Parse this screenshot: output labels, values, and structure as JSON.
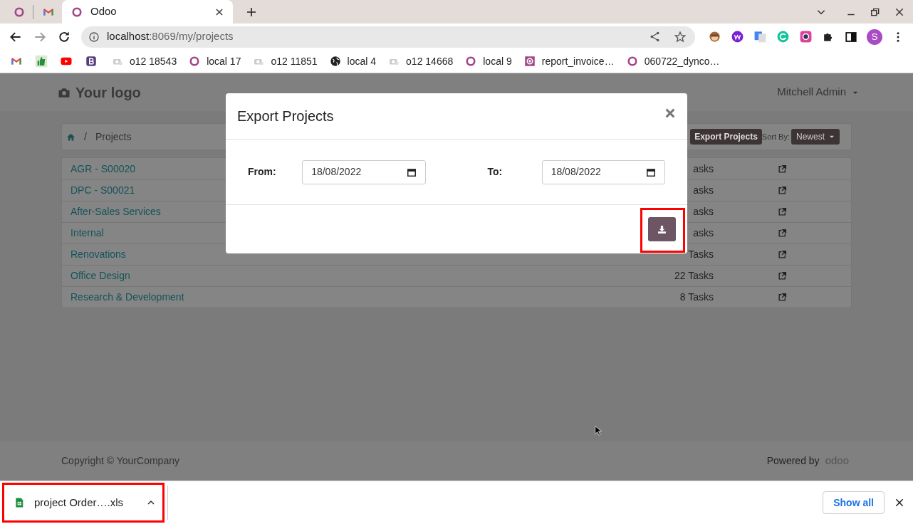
{
  "browser": {
    "tabs": [
      {
        "title": "Odoo",
        "selected": true
      }
    ],
    "address": {
      "host": "localhost",
      "rest": ":8069/my/projects"
    },
    "bookmarks": [
      {
        "kind": "gmail"
      },
      {
        "kind": "thumb"
      },
      {
        "kind": "youtube"
      },
      {
        "kind": "bootstrap"
      },
      {
        "kind": "page",
        "label": "o12 18543"
      },
      {
        "kind": "odoo",
        "label": "local 17"
      },
      {
        "kind": "page",
        "label": "o12 11851"
      },
      {
        "kind": "globe",
        "label": "local 4"
      },
      {
        "kind": "page",
        "label": "o12 14668"
      },
      {
        "kind": "odoo",
        "label": "local 9"
      },
      {
        "kind": "odoo-square",
        "label": "report_invoice…"
      },
      {
        "kind": "odoo",
        "label": "060722_dynco…"
      }
    ],
    "profile_initial": "S"
  },
  "page": {
    "logo": "Your logo",
    "user": "Mitchell Admin",
    "breadcrumb_separator": "/",
    "breadcrumb": "Projects",
    "export_button": "Export Projects",
    "sort_label": "Sort By:",
    "sort_value": "Newest",
    "projects": [
      {
        "name": "AGR - S00020",
        "tasks": "asks"
      },
      {
        "name": "DPC - S00021",
        "tasks": "asks"
      },
      {
        "name": "After-Sales Services",
        "tasks": "asks"
      },
      {
        "name": "Internal",
        "tasks": "asks"
      },
      {
        "name": "Renovations",
        "tasks": "Tasks"
      },
      {
        "name": "Office Design",
        "tasks": "22 Tasks"
      },
      {
        "name": "Research & Development",
        "tasks": "8 Tasks"
      }
    ],
    "footer": {
      "copyright": "Copyright © YourCompany",
      "powered_by": "Powered by",
      "brand": "odoo"
    }
  },
  "dialog": {
    "title": "Export Projects",
    "from_label": "From:",
    "from_value": "18/08/2022",
    "to_label": "To:",
    "to_value": "18/08/2022"
  },
  "downloads": {
    "file": "project Order….xls",
    "show_all": "Show all"
  }
}
